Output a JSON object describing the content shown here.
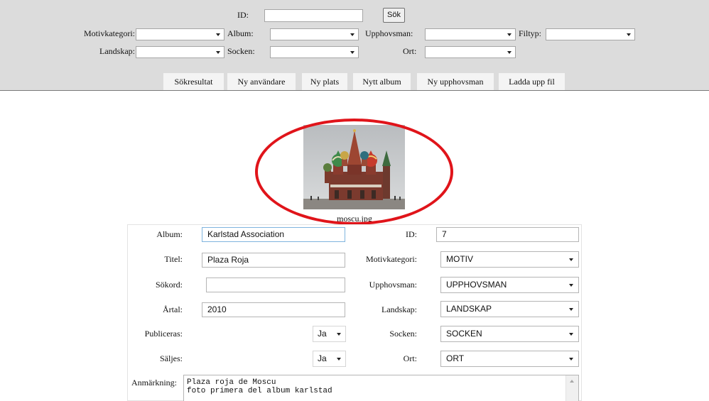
{
  "search": {
    "id_label": "ID:",
    "search_button": "Sök",
    "motivkategori_label": "Motivkategori:",
    "album_label": "Album:",
    "upphovsman_label": "Upphovsman:",
    "filtyp_label": "Filtyp:",
    "landskap_label": "Landskap:",
    "socken_label": "Socken:",
    "ort_label": "Ort:"
  },
  "tabs": [
    {
      "label": "Sökresultat"
    },
    {
      "label": "Ny användare"
    },
    {
      "label": "Ny plats"
    },
    {
      "label": "Nytt album"
    },
    {
      "label": "Ny upphovsman"
    },
    {
      "label": "Ladda upp fil"
    }
  ],
  "preview": {
    "filename": "moscu.jpg"
  },
  "form": {
    "album_label": "Album:",
    "album_value": "Karlstad Association",
    "id_label": "ID:",
    "id_value": "7",
    "titel_label": "Titel:",
    "titel_value": "Plaza Roja",
    "motivkategori_label": "Motivkategori:",
    "motivkategori_value": "MOTIV",
    "sokord_label": "Sökord:",
    "sokord_value": "",
    "upphovsman_label": "Upphovsman:",
    "upphovsman_value": "UPPHOVSMAN",
    "artal_label": "Årtal:",
    "artal_value": "2010",
    "landskap_label": "Landskap:",
    "landskap_value": "LANDSKAP",
    "publiceras_label": "Publiceras:",
    "publiceras_value": "Ja",
    "socken_label": "Socken:",
    "socken_value": "SOCKEN",
    "saljes_label": "Säljes:",
    "saljes_value": "Ja",
    "ort_label": "Ort:",
    "ort_value": "ORT",
    "anmarkning_label": "Anmärkning:",
    "anmarkning_value": "Plaza roja de Moscu\nfoto primera del album karlstad"
  },
  "colors": {
    "panel_bg": "#dcdcdc",
    "highlight_ring": "#e0141a",
    "focus_border": "#7fb4de"
  }
}
